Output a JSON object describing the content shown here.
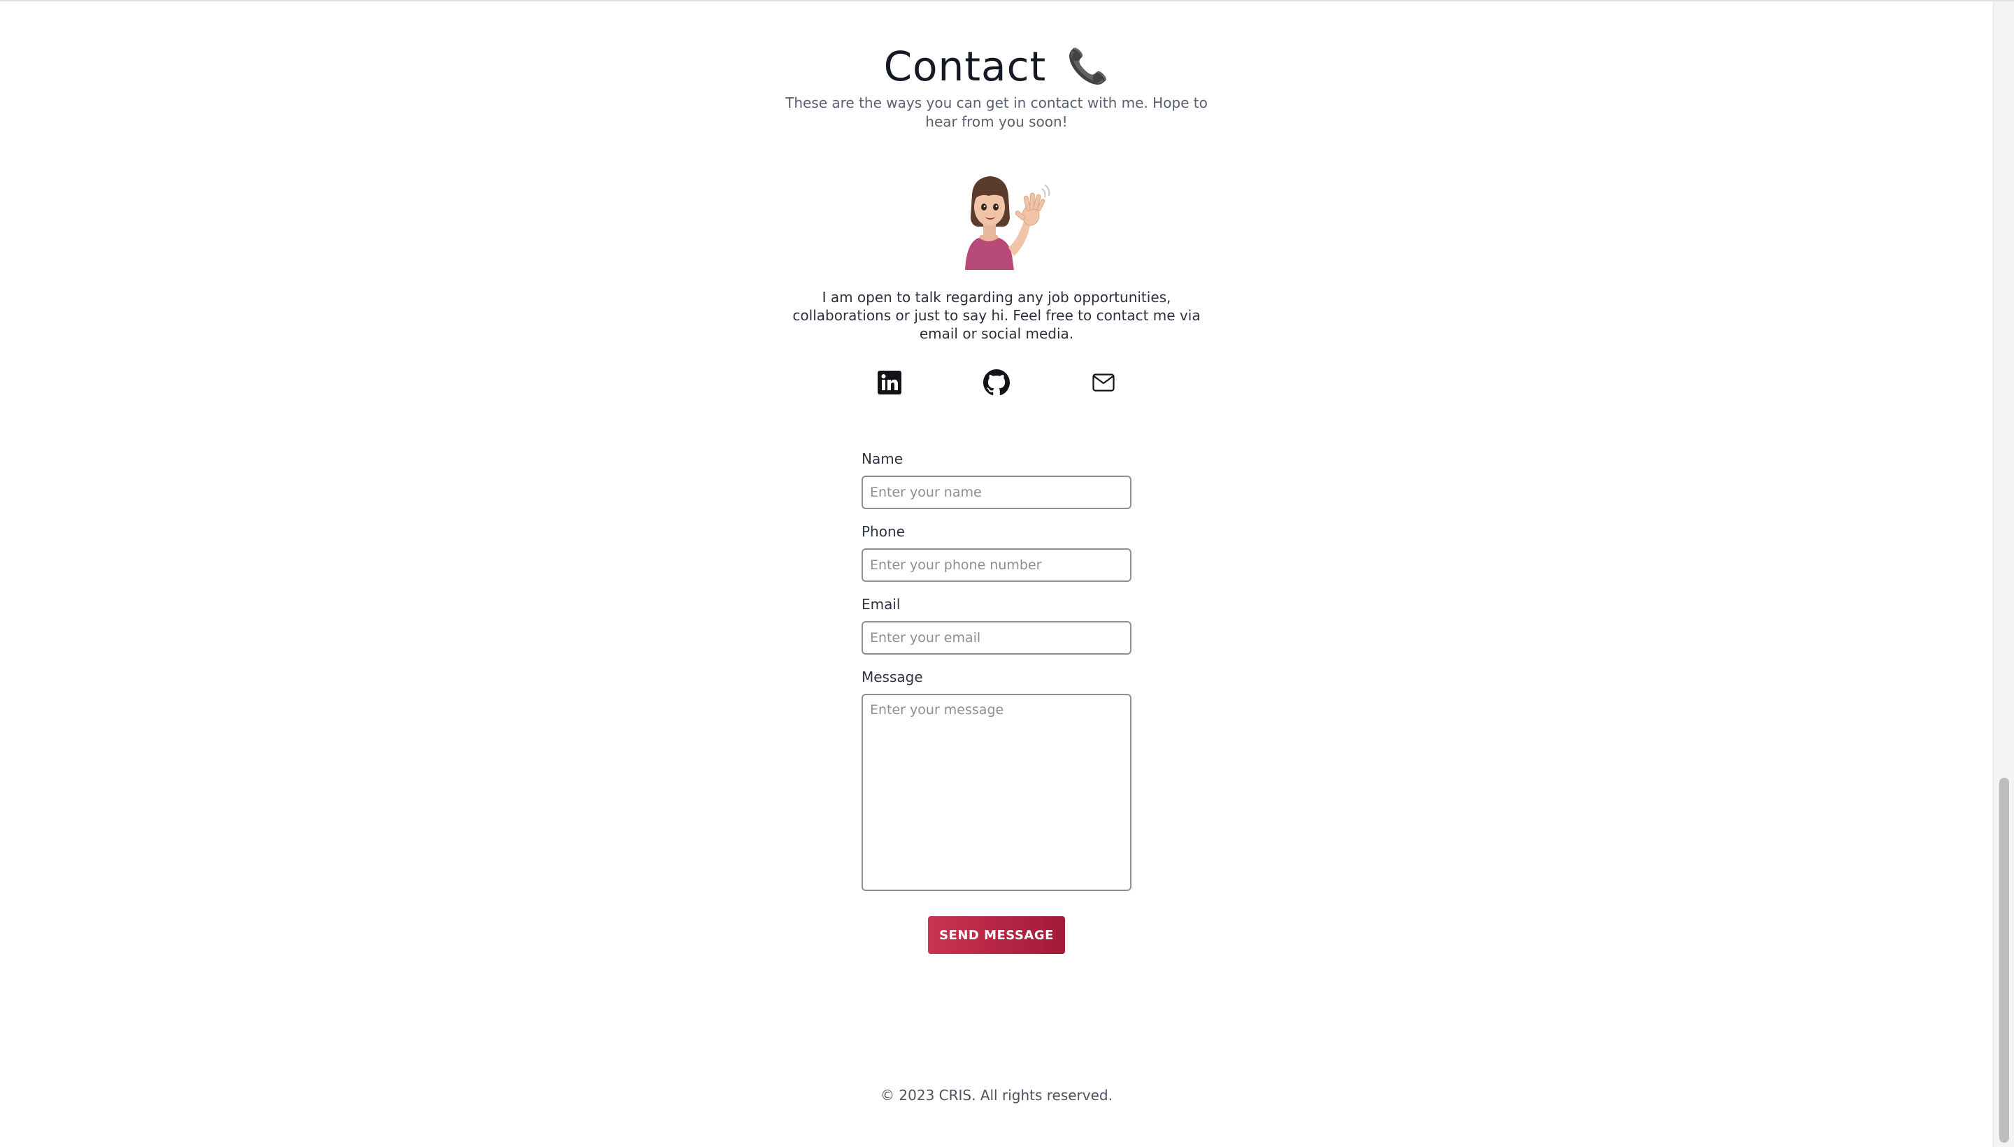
{
  "contact": {
    "title": "Contact",
    "title_emoji": "📞",
    "subtitle": "These are the ways you can get in contact with me. Hope to hear from you soon!",
    "intro": "I am open to talk regarding any job opportunities, collaborations or just to say hi. Feel free to contact me via email or social media.",
    "avatar_icon": "waving-memoji-avatar"
  },
  "socials": [
    {
      "name": "linkedin-icon"
    },
    {
      "name": "github-icon"
    },
    {
      "name": "mail-icon"
    }
  ],
  "form": {
    "name_label": "Name",
    "name_placeholder": "Enter your name",
    "phone_label": "Phone",
    "phone_placeholder": "Enter your phone number",
    "email_label": "Email",
    "email_placeholder": "Enter your email",
    "message_label": "Message",
    "message_placeholder": "Enter your message",
    "submit_label": "SEND MESSAGE"
  },
  "footer": {
    "copyright": "© 2023 CRIS. All rights reserved."
  },
  "colors": {
    "accent": "#b8253f",
    "text": "#1f2430"
  }
}
